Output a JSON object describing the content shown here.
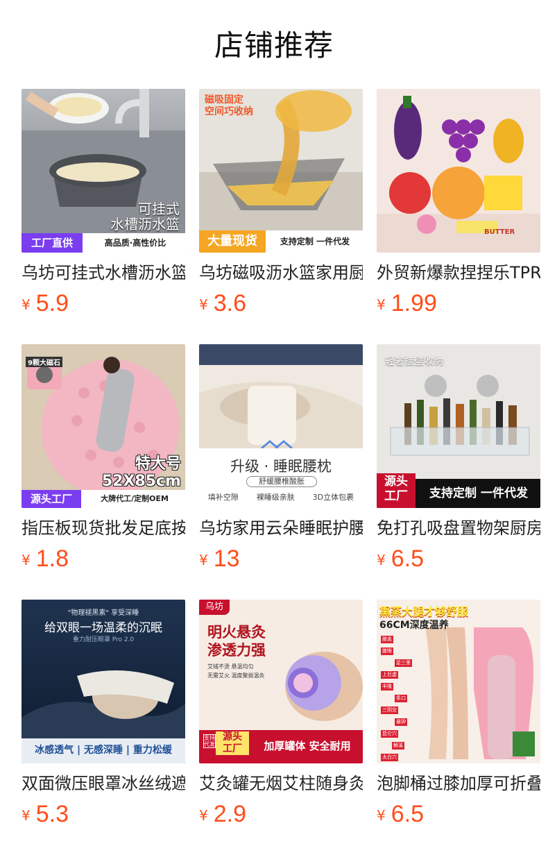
{
  "page_title": "店铺推荐",
  "currency_symbol": "¥",
  "colors": {
    "price": "#ff4d1a",
    "badge_purple": "#7b3df0",
    "badge_orange": "#f5a623",
    "badge_red": "#c8102e"
  },
  "products": [
    {
      "name": "乌坊可挂式水槽沥水篮",
      "price": "5.9",
      "img": {
        "main": "可挂式\n水槽沥水篮",
        "badge_left": "工厂直供",
        "badge_right": "高品质·高性价比"
      }
    },
    {
      "name": "乌坊磁吸沥水篮家用厨房",
      "price": "3.6",
      "img": {
        "corner": "磁吸固定\n空间巧收纳",
        "badge_left": "大量现货",
        "badge_right": "支持定制 一件代发"
      }
    },
    {
      "name": "外贸新爆款捏捏乐TPR",
      "price": "1.99",
      "img": {
        "tag": "BUTTER"
      }
    },
    {
      "name": "指压板现货批发足底按摩",
      "price": "1.8",
      "img": {
        "corner": "9颗大磁石",
        "main": "特大号\n52X85cm",
        "badge_left": "源头工厂",
        "badge_right": "大牌代工/定制OEM"
      }
    },
    {
      "name": "乌坊家用云朵睡眠护腰枕",
      "price": "13",
      "img": {
        "main": "升级 · 睡眠腰枕",
        "sub": "舒缓腰椎酸胀",
        "feats": [
          "填补空隙",
          "裸睡级亲肤",
          "3D立体包裹"
        ]
      }
    },
    {
      "name": "免打孔吸盘置物架厨房",
      "price": "6.5",
      "img": {
        "corner": "轻奢挂壁收纳",
        "badge_left": "源头\n工厂",
        "badge_right": "支持定制 一件代发"
      }
    },
    {
      "name": "双面微压眼罩冰丝绒遮光",
      "price": "5.3",
      "img": {
        "top_small": "\"物理褪黑素\" 享受深睡",
        "main": "给双眼一场温柔的沉眠",
        "tiny": "重力耐压眼罩 Pro 2.0",
        "bottom": "冰感透气 | 无感深睡 | 重力松缓"
      }
    },
    {
      "name": "艾灸罐无烟艾柱随身灸",
      "price": "2.9",
      "img": {
        "brand": "乌坊",
        "main": "明火悬灸\n渗透力强",
        "checks": [
          "艾绒不烫 悬温均匀",
          "无需艾火 温度聚拢温灸"
        ],
        "side": "支持代发",
        "badge_left": "源头\n工厂",
        "badge_right": "加厚罐体 安全耐用"
      }
    },
    {
      "name": "泡脚桶过膝加厚可折叠",
      "price": "6.5",
      "img": {
        "main": "熏蒸大腿才够舒服",
        "sub": "66CM深度温养",
        "points": [
          "膝盖",
          "膝眼",
          "足三里",
          "上巨虚",
          "丰隆",
          "条口",
          "三阴交",
          "悬钟",
          "昆仑穴",
          "解溪",
          "太白穴"
        ]
      }
    }
  ]
}
